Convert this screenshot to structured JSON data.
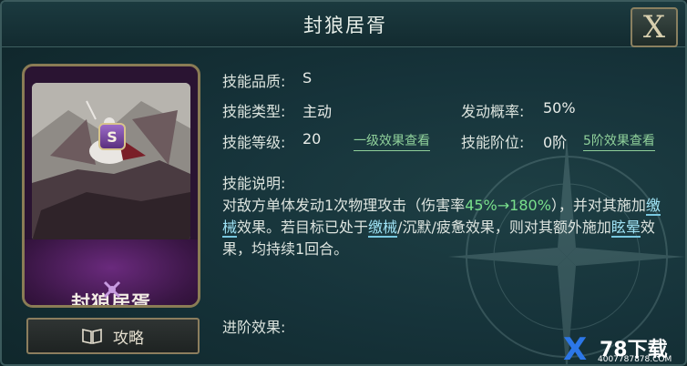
{
  "window": {
    "title": "封狼居胥",
    "close_label": "X"
  },
  "card": {
    "name": "封狼居胥",
    "grade_badge": "S"
  },
  "strategy_button": {
    "label": "攻略"
  },
  "skill": {
    "quality_label": "技能品质:",
    "quality_value": "S",
    "type_label": "技能类型:",
    "type_value": "主动",
    "probability_label": "发动概率:",
    "probability_value": "50%",
    "level_label": "技能等级:",
    "level_value": "20",
    "level_link": "一级效果查看",
    "stage_label": "技能阶位:",
    "stage_value": "0阶",
    "stage_link": "5阶效果查看",
    "desc_label": "技能说明:",
    "desc": {
      "p1": "对敌方单体发动1次物理攻击（伤害率",
      "dmg": "45%→180%",
      "p2": "），并对其施加",
      "status1": "缴械",
      "p3": "效果。若目标已处于",
      "status2": "缴械",
      "p4": "/沉默/疲惫效果，则对其额外施加",
      "status3": "眩晕",
      "p5": "效果，均持续1回合。"
    },
    "advance_label": "进阶效果:"
  },
  "watermark": {
    "mark": "X",
    "text": "78下载",
    "url": "4007787878.COM"
  },
  "colors": {
    "accent_green": "#79e08c",
    "accent_blue": "#9fe3f5",
    "gold_border": "#8a7c55"
  }
}
